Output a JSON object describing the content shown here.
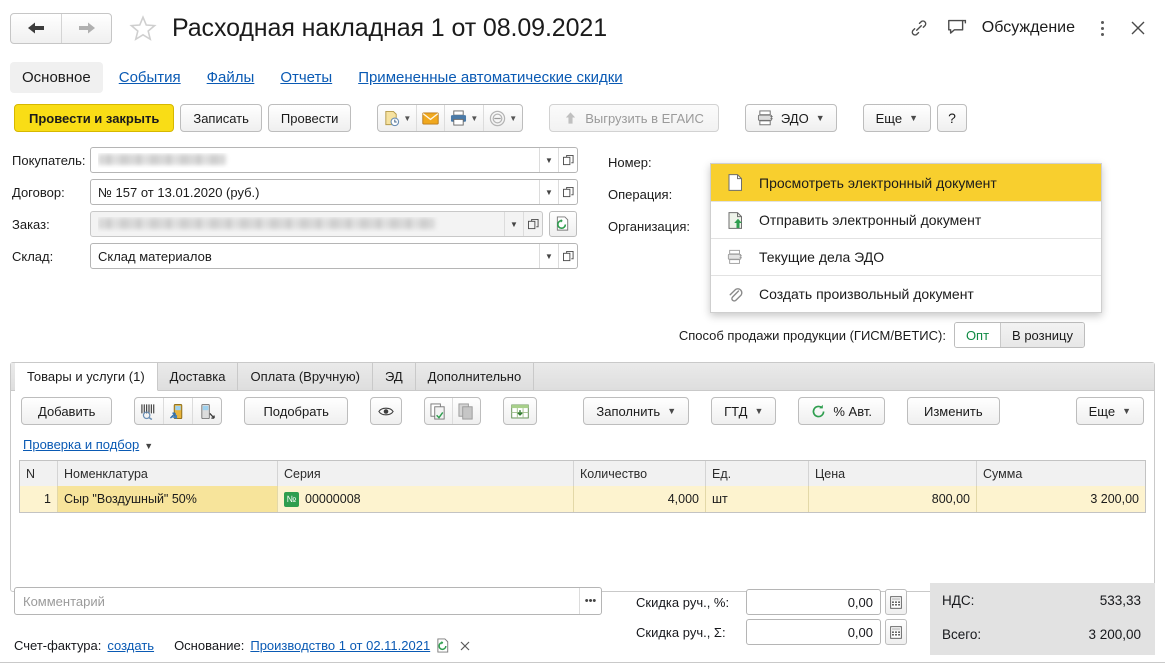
{
  "window": {
    "title": "Расходная накладная 1 от 08.09.2021",
    "back_icon": "arrow-left-icon",
    "forward_icon": "arrow-right-icon",
    "favorite_icon": "star-icon",
    "link_icon": "link-icon",
    "discussion_icon": "chat-icon",
    "discussion_label": "Обсуждение",
    "more_icon": "kebab-menu-icon",
    "close_icon": "close-icon"
  },
  "navlinks": [
    {
      "label": "Основное",
      "active": true
    },
    {
      "label": "События",
      "active": false
    },
    {
      "label": "Файлы",
      "active": false
    },
    {
      "label": "Отчеты",
      "active": false
    },
    {
      "label": "Примененные автоматические скидки",
      "active": false
    }
  ],
  "commandbar": {
    "post_and_close": "Провести и закрыть",
    "save": "Записать",
    "post": "Провести",
    "icon_report": "report-with-clock-icon",
    "icon_mail": "envelope-icon",
    "icon_print": "printer-icon",
    "icon_stamp": "seal-icon",
    "upload_egais": "Выгрузить в ЕГАИС",
    "upload_egais_icon": "upload-arrow-icon",
    "edo": "ЭДО",
    "edo_icon": "edo-stack-icon",
    "more": "Еще",
    "help": "?"
  },
  "edo_menu": [
    {
      "label": "Просмотреть электронный документ",
      "icon": "document-icon",
      "selected": true
    },
    {
      "label": "Отправить электронный документ",
      "icon": "document-send-icon",
      "selected": false
    },
    {
      "label": "Текущие дела ЭДО",
      "icon": "edo-stack-icon",
      "selected": false
    },
    {
      "label": "Создать произвольный документ",
      "icon": "paperclip-icon",
      "selected": false
    }
  ],
  "form": {
    "fields": [
      {
        "label": "Покупатель:",
        "value": "",
        "blurred": true,
        "readonly": false,
        "has_open": true
      },
      {
        "label": "Договор:",
        "value": "№ 157 от 13.01.2020 (руб.)",
        "blurred": false,
        "readonly": false,
        "has_open": true
      },
      {
        "label": "Заказ:",
        "value": "",
        "blurred": true,
        "readonly": true,
        "has_open": true
      },
      {
        "label": "Склад:",
        "value": "Склад материалов",
        "blurred": false,
        "readonly": false,
        "has_open": true
      }
    ],
    "right_labels": [
      "Номер:",
      "Операция:",
      "Организация:"
    ]
  },
  "gism": {
    "label": "Способ продажи продукции (ГИСМ/ВЕТИС):",
    "options": [
      {
        "label": "Опт",
        "selected": true
      },
      {
        "label": "В розницу",
        "selected": false
      }
    ]
  },
  "tabs": [
    {
      "label": "Товары и услуги (1)",
      "active": true
    },
    {
      "label": "Доставка",
      "active": false
    },
    {
      "label": "Оплата (Вручную)",
      "active": false
    },
    {
      "label": "ЭД",
      "active": false
    },
    {
      "label": "Дополнительно",
      "active": false
    }
  ],
  "table_toolbar": {
    "add": "Добавить",
    "barcode_icon": "barcode-scan-icon",
    "tsd_in_icon": "tsd-upload-icon",
    "tsd_out_icon": "tsd-download-icon",
    "pick": "Подобрать",
    "view_icon": "eye-icon",
    "copy_icon": "copy-icon",
    "paste_icon": "paste-icon",
    "excel_icon": "spreadsheet-icon",
    "fill": "Заполнить",
    "gtd": "ГТД",
    "auto_percent": "% Авт.",
    "auto_percent_icon": "refresh-icon",
    "change": "Изменить",
    "more": "Еще",
    "check_and_pick": "Проверка и подбор"
  },
  "grid": {
    "columns": [
      "N",
      "Номенклатура",
      "Серия",
      "Количество",
      "Ед.",
      "Цена",
      "Сумма"
    ],
    "rows": [
      {
        "n": "1",
        "nomenclature": "Сыр \"Воздушный\" 50%",
        "series": "00000008",
        "series_icon": "series-badge-icon",
        "quantity": "4,000",
        "unit": "шт",
        "price": "800,00",
        "sum": "3 200,00"
      }
    ]
  },
  "footer": {
    "comment_placeholder": "Комментарий",
    "comment_value": "",
    "comment_more_icon": "ellipsis-icon",
    "invoice_label": "Счет-фактура:",
    "invoice_link": "создать",
    "basis_label": "Основание:",
    "basis_link": "Производство 1 от 02.11.2021",
    "basis_open_icon": "open-document-icon",
    "basis_clear_icon": "clear-icon",
    "discounts": [
      {
        "label": "Скидка руч., %:",
        "value": "0,00",
        "calc_icon": "calculator-icon"
      },
      {
        "label": "Скидка руч., Σ:",
        "value": "0,00",
        "calc_icon": "calculator-icon"
      }
    ],
    "totals": [
      {
        "label": "НДС:",
        "value": "533,33"
      },
      {
        "label": "Всего:",
        "value": "3 200,00"
      }
    ]
  },
  "colors": {
    "accent_yellow": "#f9dd16",
    "menu_highlight": "#f8cf2e",
    "row_highlight": "#fdf3cf",
    "cell_highlight": "#f7e49b",
    "link_blue": "#0a5ab4",
    "green": "#0f8a44"
  }
}
